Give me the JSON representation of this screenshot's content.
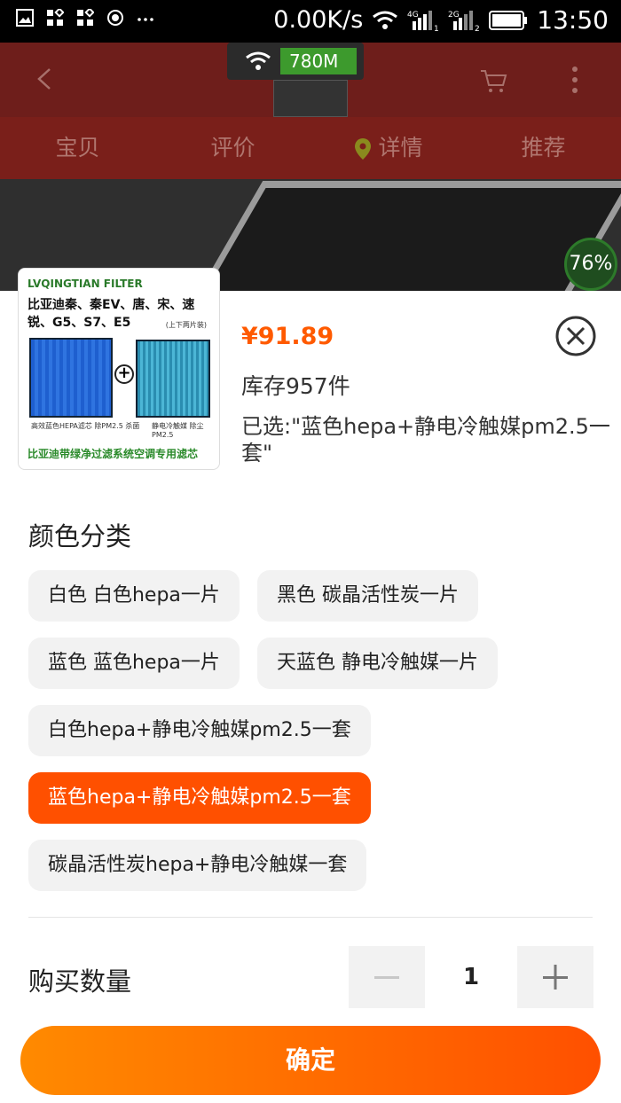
{
  "status_bar": {
    "speed": "0.00K/s",
    "time": "13:50",
    "net_4g": "4G",
    "net_2g": "2G",
    "sim1": "1",
    "sim2": "2"
  },
  "background": {
    "tabs": [
      "宝贝",
      "评价",
      "详情",
      "推荐"
    ],
    "net_speed": "780M",
    "progress": "76%"
  },
  "product": {
    "price": "¥91.89",
    "stock": "库存957件",
    "selected": "已选:\"蓝色hepa+静电冷触媒pm2.5一套\"",
    "image": {
      "brand": "LVQINGTIAN FILTER",
      "models": "比亚迪秦、秦EV、唐、宋、速锐、G5、S7、E5",
      "sub": "(上下两片装)",
      "caption_left": "高效蓝色HEPA滤芯 除PM2.5 杀菌",
      "caption_right": "静电冷触媒 除尘PM2.5",
      "slogan": "比亚迪带绿净过滤系统空调专用滤芯"
    }
  },
  "color_section": {
    "title": "颜色分类",
    "options": [
      "白色 白色hepa一片",
      "黑色 碳晶活性炭一片",
      "蓝色 蓝色hepa一片",
      "天蓝色 静电冷触媒一片",
      "白色hepa+静电冷触媒pm2.5一套",
      "蓝色hepa+静电冷触媒pm2.5一套",
      "碳晶活性炭hepa+静电冷触媒一套"
    ],
    "selected_index": 5
  },
  "quantity": {
    "label": "购买数量",
    "value": "1"
  },
  "confirm_label": "确定",
  "colors": {
    "accent": "#ff5000",
    "price": "#ff5a00"
  }
}
